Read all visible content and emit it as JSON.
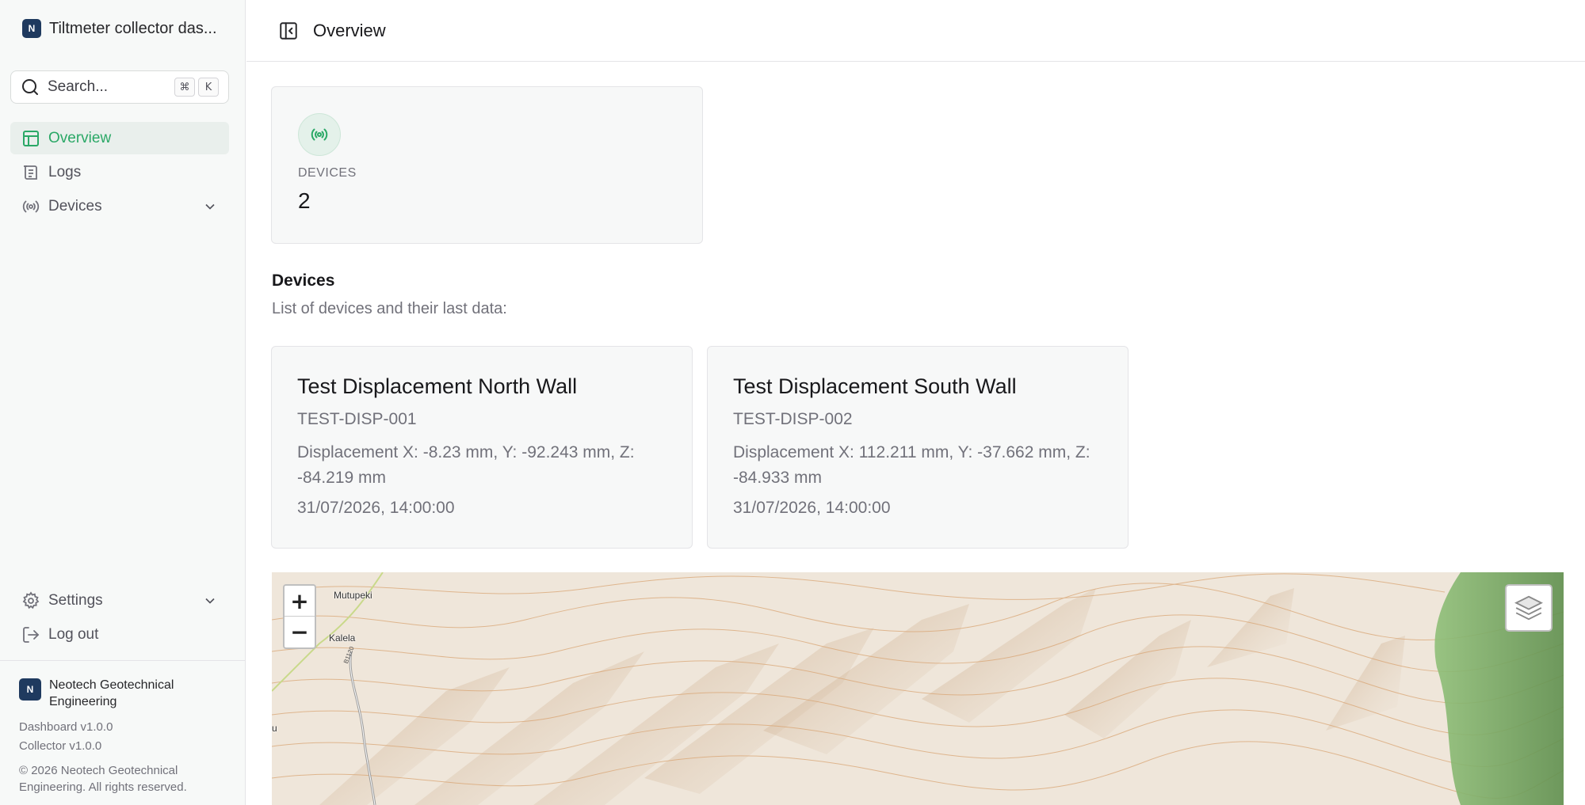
{
  "sidebar": {
    "app_logo": "N",
    "app_title": "Tiltmeter collector das...",
    "search": {
      "placeholder": "Search...",
      "shortcut_mod": "⌘",
      "shortcut_key": "K"
    },
    "nav": [
      {
        "label": "Overview",
        "icon": "layout-icon",
        "active": true
      },
      {
        "label": "Logs",
        "icon": "logs-icon",
        "active": false
      },
      {
        "label": "Devices",
        "icon": "broadcast-icon",
        "expandable": true
      }
    ],
    "bottom_nav": [
      {
        "label": "Settings",
        "icon": "gear-icon",
        "expandable": true
      },
      {
        "label": "Log out",
        "icon": "logout-icon"
      }
    ],
    "footer": {
      "org_logo": "N",
      "org_name": "Neotech Geotechnical Engineering",
      "dashboard_version": "Dashboard v1.0.0",
      "collector_version": "Collector v1.0.0",
      "copyright": "© 2026 Neotech Geotechnical Engineering. All rights reserved."
    }
  },
  "header": {
    "title": "Overview"
  },
  "stats": {
    "devices_label": "DEVICES",
    "devices_value": "2"
  },
  "devices_section": {
    "title": "Devices",
    "subtitle": "List of devices and their last data:",
    "cards": [
      {
        "name": "Test Displacement North Wall",
        "id": "TEST-DISP-001",
        "displacement": "Displacement X: -8.23 mm, Y: -92.243 mm, Z: -84.219 mm",
        "timestamp": "31/07/2026, 14:00:00"
      },
      {
        "name": "Test Displacement South Wall",
        "id": "TEST-DISP-002",
        "displacement": "Displacement X: 112.211 mm, Y: -37.662 mm, Z: -84.933 mm",
        "timestamp": "31/07/2026, 14:00:00"
      }
    ]
  },
  "map": {
    "zoom_in": "+",
    "zoom_out": "−",
    "places": [
      "Mutupeki",
      "Kalela"
    ],
    "road_label": "B1120",
    "edge_label": "u",
    "colors": {
      "terrain": "#efe6da",
      "contour": "#d9a574",
      "forest": "#7fae6a",
      "road": "#9a9a9a",
      "road_green": "#c9d98a"
    }
  },
  "colors": {
    "accent": "#2aa866",
    "sidebar_bg": "#f7f9f8",
    "card_bg": "#f7f8f8",
    "active_bg": "#e9efec"
  }
}
